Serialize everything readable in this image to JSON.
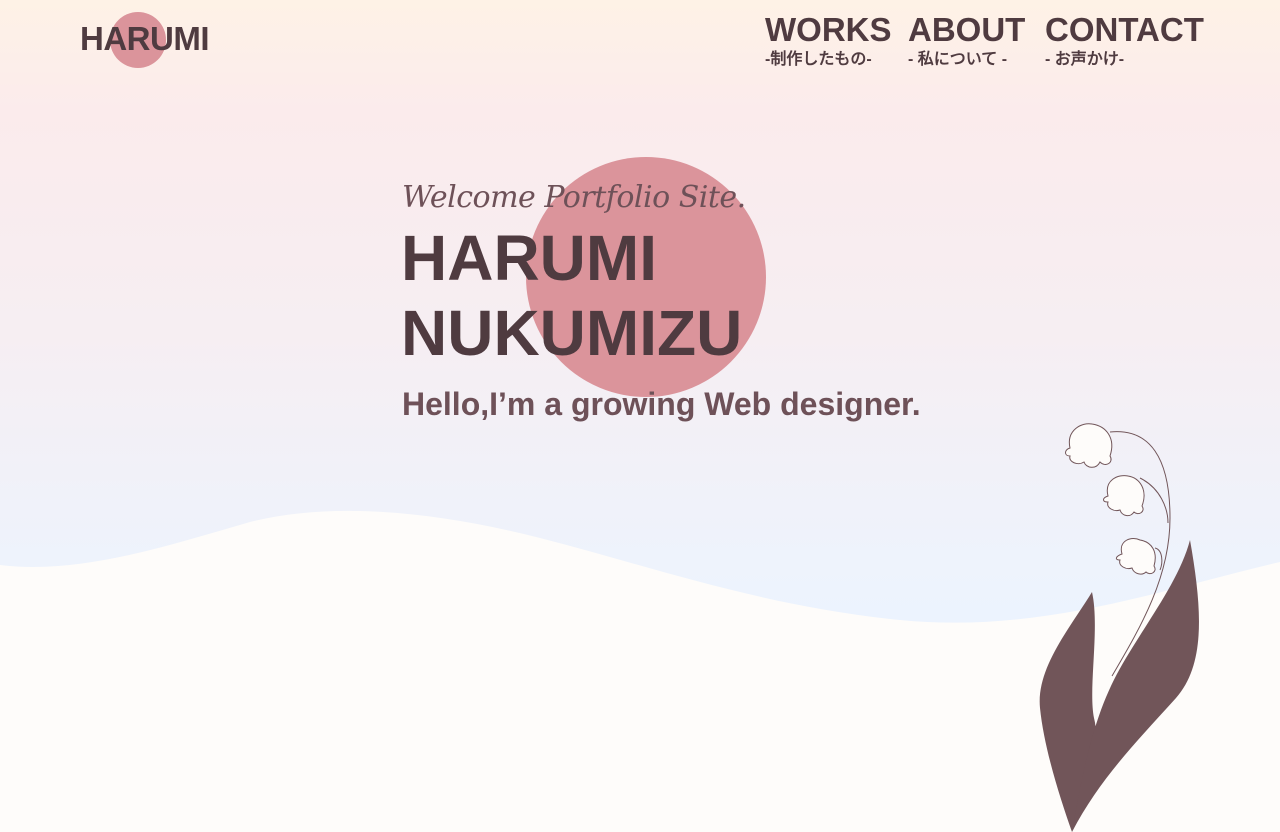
{
  "header": {
    "logo": "HARUMI",
    "nav": [
      {
        "title": "WORKS",
        "sub": "-制作したもの-"
      },
      {
        "title": "ABOUT",
        "sub": "- 私について -"
      },
      {
        "title": "CONTACT",
        "sub": "- お声かけ-"
      }
    ]
  },
  "hero": {
    "welcome": "Welcome Portfolio Site.",
    "name_line1": "HARUMI",
    "name_line2": "NUKUMIZU",
    "tagline": "Hello,I’m a growing Web designer."
  },
  "colors": {
    "accent_circle": "#db949b",
    "text_dark": "#4f3b40",
    "text_muted": "#6e5158",
    "leaf": "#715559",
    "wave_fill": "#fefcfa"
  },
  "icons": {
    "plant": "lily-of-the-valley-icon"
  }
}
